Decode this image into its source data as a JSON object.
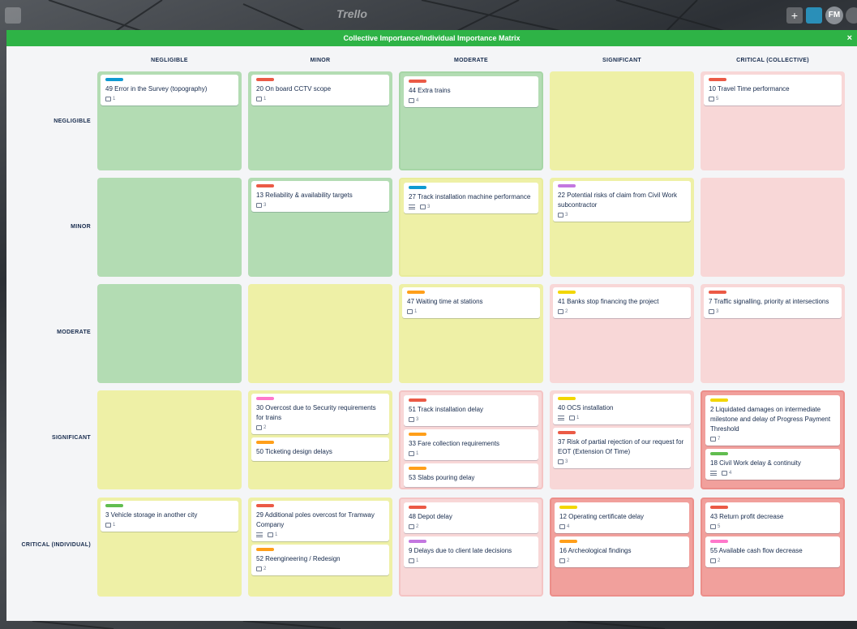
{
  "topbar": {
    "logo": "Trello",
    "plus": "+",
    "avatar": "FM"
  },
  "modal": {
    "title": "Collective Importance/Individual Importance Matrix",
    "close": "×"
  },
  "columns": [
    "NEGLIGIBLE",
    "MINOR",
    "MODERATE",
    "SIGNIFICANT",
    "CRITICAL (COLLECTIVE)"
  ],
  "rows": [
    "NEGLIGIBLE",
    "MINOR",
    "MODERATE",
    "SIGNIFICANT",
    "CRITICAL (INDIVIDUAL)"
  ],
  "label_colors": {
    "blue": "#0e9ad2",
    "red": "#eb5a46",
    "purple": "#c377e0",
    "orange": "#ff9f1a",
    "yellow": "#f2d600",
    "pink": "#ff78cb",
    "green": "#61bd4f"
  },
  "cell_colors": {
    "green": "#b3dcb3",
    "yellow": "#eef0a6",
    "pink": "#f8d7d7",
    "red": "#f1a09c"
  },
  "cells": {
    "r0c0": [
      {
        "label": "blue",
        "title": "49 Error in the Survey (topography)",
        "comments": "1"
      }
    ],
    "r0c1": [
      {
        "label": "red",
        "title": "20 On board CCTV scope",
        "comments": "1"
      }
    ],
    "r0c2": [
      {
        "label": "red",
        "title": "44 Extra trains",
        "comments": "4"
      }
    ],
    "r0c4": [
      {
        "label": "red",
        "title": "10 Travel Time performance",
        "comments": "5"
      }
    ],
    "r1c1": [
      {
        "label": "red",
        "title": "13 Reliability & availability targets",
        "comments": "3"
      }
    ],
    "r1c2": [
      {
        "label": "blue",
        "title": "27 Track installation machine performance",
        "desc": true,
        "comments": "3"
      }
    ],
    "r1c3": [
      {
        "label": "purple",
        "title": "22 Potential risks of claim from Civil Work subcontractor",
        "comments": "3"
      }
    ],
    "r2c2": [
      {
        "label": "orange",
        "title": "47 Waiting time at stations",
        "comments": "1"
      }
    ],
    "r2c3": [
      {
        "label": "yellow",
        "title": "41 Banks stop financing the project",
        "comments": "2"
      }
    ],
    "r2c4": [
      {
        "label": "red",
        "title": "7 Traffic signalling, priority at intersections",
        "comments": "3"
      }
    ],
    "r3c1": [
      {
        "label": "pink",
        "title": "30 Overcost due to Security requirements for trains",
        "comments": "2"
      },
      {
        "label": "orange",
        "title": "50 Ticketing design delays"
      }
    ],
    "r3c2": [
      {
        "label": "red",
        "title": "51 Track installation delay",
        "comments": "3"
      },
      {
        "label": "orange",
        "title": "33 Fare collection requirements",
        "comments": "1"
      },
      {
        "label": "orange",
        "title": "53 Slabs pouring delay"
      }
    ],
    "r3c3": [
      {
        "label": "yellow",
        "title": "40 OCS installation",
        "desc": true,
        "comments": "1"
      },
      {
        "label": "red",
        "title": "37 Risk of partial rejection of our request for EOT (Extension Of Time)",
        "comments": "3"
      }
    ],
    "r3c4": [
      {
        "label": "yellow",
        "title": "2 Liquidated damages on intermediate milestone and delay of Progress Payment Threshold",
        "comments": "7"
      },
      {
        "label": "green",
        "title": "18 Civil Work delay & continuity",
        "desc": true,
        "comments": "4"
      }
    ],
    "r4c0": [
      {
        "label": "green",
        "title": "3 Vehicle storage in another city",
        "comments": "1"
      }
    ],
    "r4c1": [
      {
        "label": "red",
        "title": "29 Additional poles overcost for Tramway Company",
        "desc": true,
        "comments": "1"
      },
      {
        "label": "orange",
        "title": "52 Reengineering / Redesign",
        "comments": "2"
      }
    ],
    "r4c2": [
      {
        "label": "red",
        "title": "48 Depot delay",
        "comments": "2"
      },
      {
        "label": "purple",
        "title": "9 Delays due to client late decisions",
        "comments": "1"
      }
    ],
    "r4c3": [
      {
        "label": "yellow",
        "title": "12 Operating certificate delay",
        "comments": "4"
      },
      {
        "label": "orange",
        "title": "16 Archeological findings",
        "comments": "2"
      }
    ],
    "r4c4": [
      {
        "label": "red",
        "title": "43 Return profit decrease",
        "comments": "5"
      },
      {
        "label": "pink",
        "title": "55 Available cash flow decrease",
        "comments": "2"
      }
    ]
  }
}
